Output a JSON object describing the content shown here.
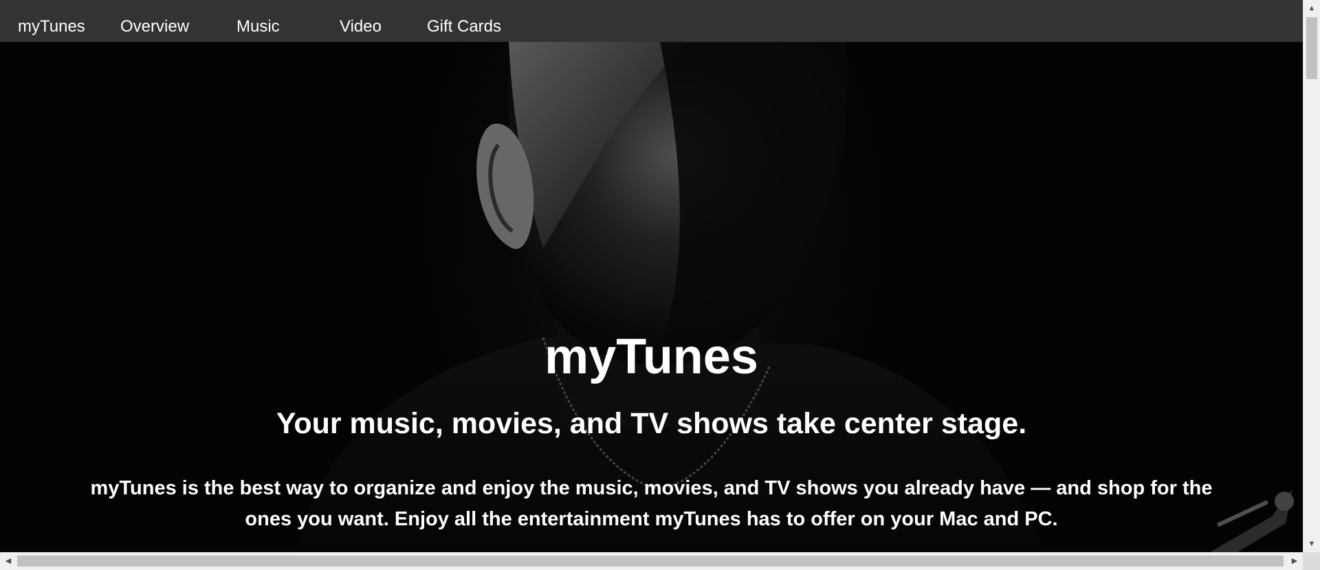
{
  "nav": {
    "items": [
      {
        "label": "myTunes"
      },
      {
        "label": "Overview"
      },
      {
        "label": "Music"
      },
      {
        "label": "Video"
      },
      {
        "label": "Gift Cards"
      }
    ]
  },
  "hero": {
    "title": "myTunes",
    "subtitle": "Your music, movies, and TV shows take center stage.",
    "body": "myTunes is the best way to organize and enjoy the music, movies, and TV shows you already have — and shop for the ones you want. Enjoy all the entertainment myTunes has to offer on your Mac and PC.",
    "image": "black-and-white portrait of a man"
  },
  "scrollbars": {
    "up_icon": "arrow-up-icon",
    "down_icon": "arrow-down-icon",
    "left_icon": "arrow-left-icon",
    "right_icon": "arrow-right-icon"
  },
  "colors": {
    "navbar": "#333333",
    "hero_bg": "#000000",
    "text": "#ffffff"
  }
}
